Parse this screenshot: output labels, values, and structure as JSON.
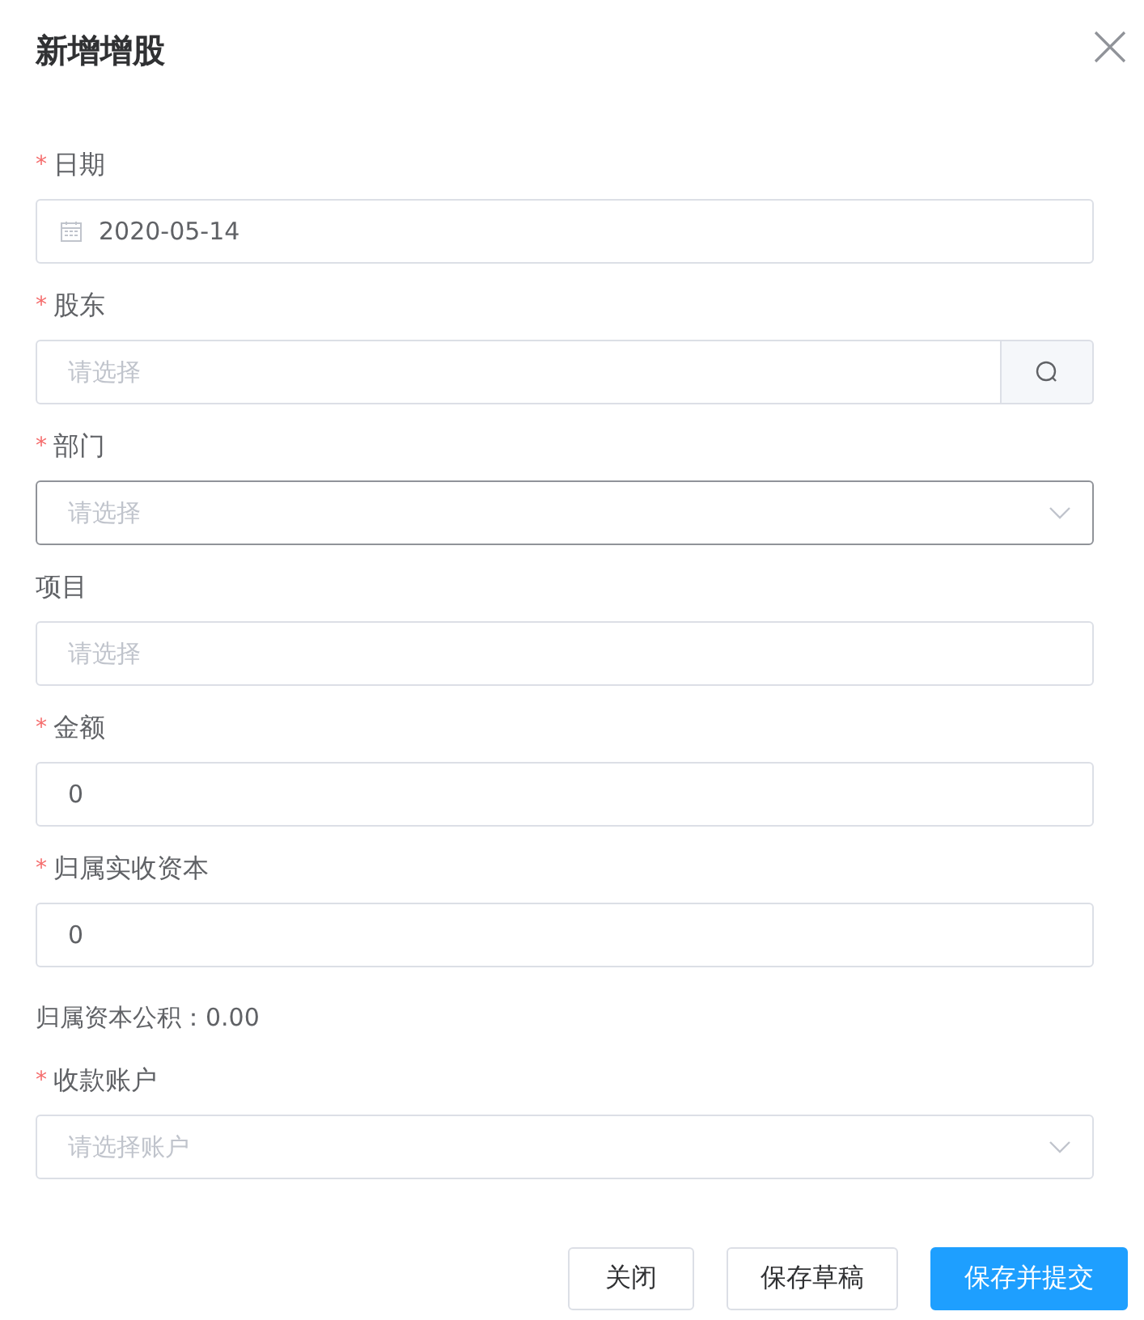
{
  "dialog": {
    "title": "新增增股"
  },
  "fields": [
    {
      "kind": "date",
      "label": "日期",
      "required_mark": "*",
      "value": "2020-05-14"
    },
    {
      "kind": "search",
      "label": "股东",
      "required_mark": "*",
      "placeholder": "请选择"
    },
    {
      "kind": "select",
      "label": "部门",
      "required_mark": "*",
      "placeholder": "请选择",
      "focused": true
    },
    {
      "kind": "input",
      "label": "项目",
      "placeholder": "请选择"
    },
    {
      "kind": "input",
      "label": "金额",
      "required_mark": "*",
      "value": "0"
    },
    {
      "kind": "input",
      "label": "归属实收资本",
      "required_mark": "*",
      "value": "0"
    },
    {
      "kind": "readout",
      "text": "归属资本公积：0.00"
    },
    {
      "kind": "select",
      "label": "收款账户",
      "required_mark": "*",
      "placeholder": "请选择账户",
      "focused": false
    }
  ],
  "buttons": [
    {
      "label": "关闭",
      "kind": "default"
    },
    {
      "label": "保存草稿",
      "kind": "default"
    },
    {
      "label": "保存并提交",
      "kind": "primary"
    }
  ]
}
